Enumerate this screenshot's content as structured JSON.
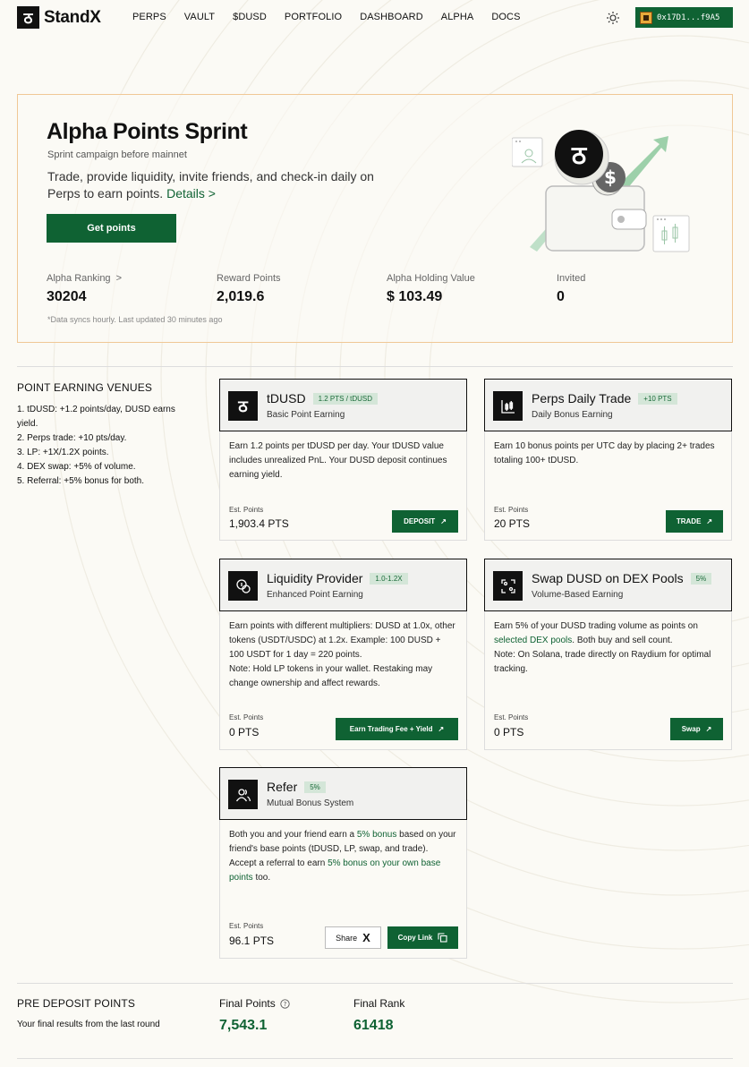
{
  "header": {
    "logo_glyph": "ठ",
    "brand": "StandX",
    "nav": [
      "PERPS",
      "VAULT",
      "$DUSD",
      "PORTFOLIO",
      "DASHBOARD",
      "ALPHA",
      "DOCS"
    ],
    "wallet": "0x17D1...f9A5",
    "theme_icon": "sun-icon"
  },
  "hero": {
    "title": "Alpha Points Sprint",
    "subtitle": "Sprint campaign before mainnet",
    "description": "Trade, provide liquidity, invite friends, and check-in daily on Perps to earn points.",
    "details_link": "Details >",
    "cta": "Get points",
    "stats": [
      {
        "label": "Alpha Ranking",
        "value": "30204",
        "chevron": ">"
      },
      {
        "label": "Reward Points",
        "value": "2,019.6"
      },
      {
        "label": "Alpha Holding Value",
        "value": "$ 103.49"
      },
      {
        "label": "Invited",
        "value": "0"
      }
    ],
    "note": "*Data syncs hourly. Last updated 30 minutes ago",
    "art_coin_glyph": "ठ",
    "art_dollar_glyph": "$"
  },
  "venues": {
    "title": "POINT EARNING VENUES",
    "items": [
      "1. tDUSD: +1.2 points/day, DUSD earns yield.",
      "2. Perps trade: +10 pts/day.",
      "3. LP: +1X/1.2X points.",
      "4. DEX swap: +5% of volume.",
      "5. Referral: +5% bonus for both."
    ]
  },
  "cards": {
    "tdusd": {
      "icon": "standx-logo-icon",
      "glyph": "ठ",
      "title": "tDUSD",
      "tag": "1.2 PTS / tDUSD",
      "subtitle": "Basic Point Earning",
      "body": "Earn 1.2 points per tDUSD per day. Your tDUSD value includes unrealized PnL. Your DUSD deposit continues earning yield.",
      "est_label": "Est. Points",
      "est_value": "1,903.4 PTS",
      "button": "DEPOSIT",
      "arrow": "↗"
    },
    "perps": {
      "icon": "chart-icon",
      "title": "Perps Daily Trade",
      "tag": "+10 PTS",
      "subtitle": "Daily Bonus Earning",
      "body": "Earn 10 bonus points per UTC day by placing 2+ trades totaling 100+ tDUSD.",
      "est_label": "Est. Points",
      "est_value": "20 PTS",
      "button": "TRADE",
      "arrow": "↗"
    },
    "lp": {
      "icon": "coins-icon",
      "title": "Liquidity Provider",
      "tag": "1.0-1.2X",
      "subtitle": "Enhanced Point Earning",
      "body": "Earn points with different multipliers: DUSD at 1.0x, other tokens (USDT/USDC) at 1.2x. Example: 100 DUSD + 100 USDT for 1 day = 220 points.",
      "note": "Note: Hold LP tokens in your wallet. Restaking may change ownership and affect rewards.",
      "est_label": "Est. Points",
      "est_value": "0 PTS",
      "button": "Earn Trading Fee + Yield",
      "arrow": "↗"
    },
    "swap": {
      "icon": "swap-icon",
      "title": "Swap DUSD on DEX Pools",
      "tag": "5%",
      "subtitle": "Volume-Based Earning",
      "body_pre": "Earn 5% of your DUSD trading volume as points on ",
      "body_link": "selected DEX pools",
      "body_post": ". Both buy and sell count.",
      "note": "Note: On Solana, trade directly on Raydium for optimal tracking.",
      "est_label": "Est. Points",
      "est_value": "0 PTS",
      "button": "Swap",
      "arrow": "↗"
    },
    "refer": {
      "icon": "users-icon",
      "title": "Refer",
      "tag": "5%",
      "subtitle": "Mutual Bonus System",
      "body_pre": "Both you and your friend earn a ",
      "body_link": "5% bonus",
      "body_post": " based on your friend's base points (tDUSD, LP, swap, and trade).",
      "line2_pre": "Accept a referral to earn ",
      "line2_link": "5% bonus on your own base points",
      "line2_post": " too.",
      "est_label": "Est. Points",
      "est_value": "96.1 PTS",
      "share": "Share",
      "share_glyph": "X",
      "copy": "Copy Link"
    }
  },
  "predeposit": {
    "title": "PRE DEPOSIT POINTS",
    "subtitle": "Your final results from the last round",
    "final_points_label": "Final Points",
    "final_points": "7,543.1",
    "final_rank_label": "Final Rank",
    "final_rank": "61418"
  }
}
